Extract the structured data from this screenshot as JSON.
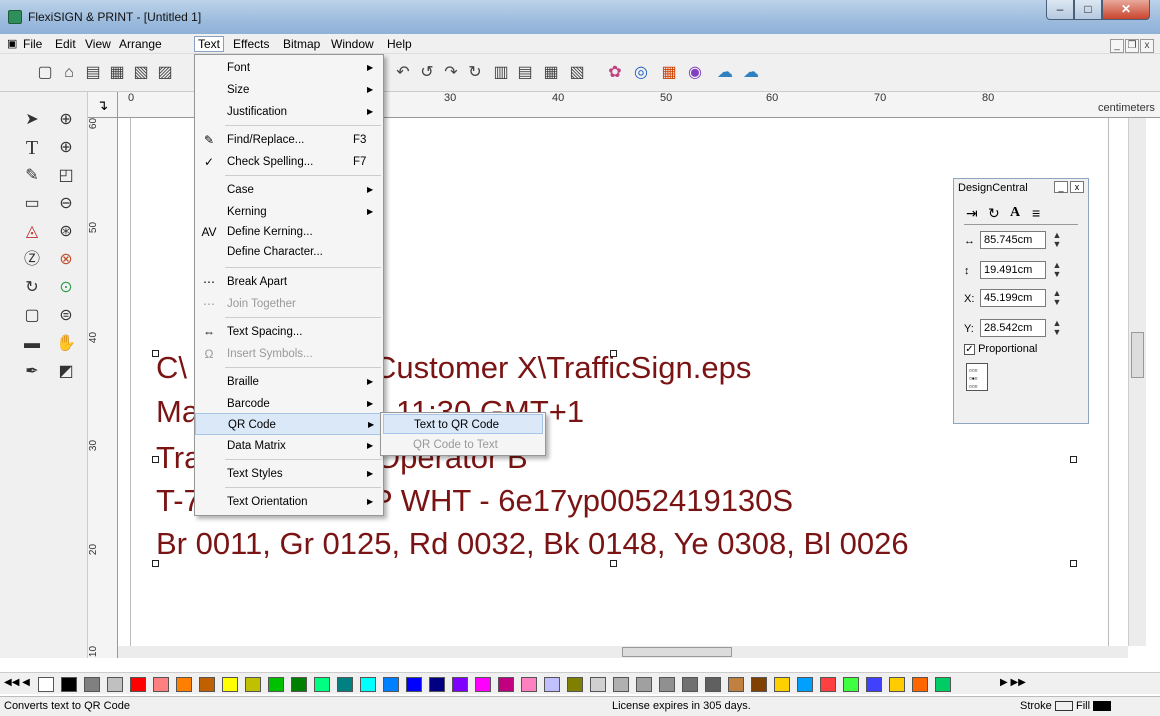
{
  "window": {
    "title": "FlexiSIGN & PRINT - [Untitled 1]"
  },
  "menubar": {
    "items": [
      "File",
      "Edit",
      "View",
      "Arrange",
      "Text",
      "Effects",
      "Bitmap",
      "Window",
      "Help"
    ]
  },
  "ruler": {
    "h_labels": [
      "0",
      "30",
      "40",
      "50",
      "60",
      "70",
      "80"
    ],
    "unit": "centimeters",
    "v_labels": [
      "60",
      "50",
      "40",
      "30",
      "20",
      "10"
    ]
  },
  "text_menu": {
    "items": [
      {
        "label": "Font",
        "submenu": true
      },
      {
        "label": "Size",
        "submenu": true
      },
      {
        "label": "Justification",
        "submenu": true
      },
      {
        "label": "Find/Replace...",
        "shortcut": "F3"
      },
      {
        "label": "Check Spelling...",
        "shortcut": "F7"
      },
      {
        "label": "Case",
        "submenu": true
      },
      {
        "label": "Kerning",
        "submenu": true
      },
      {
        "label": "Define Kerning..."
      },
      {
        "label": "Define Character..."
      },
      {
        "label": "Break Apart"
      },
      {
        "label": "Join Together",
        "disabled": true
      },
      {
        "label": "Text Spacing..."
      },
      {
        "label": "Insert Symbols...",
        "disabled": true
      },
      {
        "label": "Braille",
        "submenu": true
      },
      {
        "label": "Barcode",
        "submenu": true
      },
      {
        "label": "QR Code",
        "submenu": true,
        "highlighted": true
      },
      {
        "label": "Data Matrix",
        "submenu": true
      },
      {
        "label": "Text Styles",
        "submenu": true
      },
      {
        "label": "Text Orientation",
        "submenu": true
      }
    ]
  },
  "qr_submenu": {
    "items": [
      {
        "label": "Text to QR Code",
        "highlighted": true
      },
      {
        "label": "QR Code to Text",
        "disabled": true
      }
    ]
  },
  "canvas_text": {
    "line1_a": "C\\",
    "line1_b": "Customer X\\TrafficSign.eps",
    "line2_a": "Ma",
    "line2_b": "11:30 GMT+1",
    "line3_a": "Tra",
    "line3_b": "Operator B",
    "line4_a": "T-7",
    "line4_b": "P WHT - 6e17yp0052419130S",
    "line5": "Br 0011, Gr 0125, Rd 0032, Bk 0148, Ye 0308, Bl 0026"
  },
  "design_central": {
    "title": "DesignCentral",
    "width": "85.745cm",
    "height": "19.491cm",
    "x_label": "X:",
    "x": "45.199cm",
    "y_label": "Y:",
    "y": "28.542cm",
    "proportional_label": "Proportional",
    "proportional_checked": true
  },
  "status": {
    "message": "Converts text to QR Code",
    "license": "License expires in 305 days.",
    "stroke_label": "Stroke",
    "fill_label": "Fill"
  },
  "palette_colors": [
    "#ffffff",
    "#000000",
    "#808080",
    "#c0c0c0",
    "#ff0000",
    "#ff8080",
    "#ff8000",
    "#c06000",
    "#ffff00",
    "#c0c000",
    "#00c000",
    "#008000",
    "#00ff80",
    "#008080",
    "#00ffff",
    "#0080ff",
    "#0000ff",
    "#000080",
    "#8000ff",
    "#ff00ff",
    "#c00080",
    "#ff80c0",
    "#c0c0ff",
    "#808000",
    "#d0d0d0",
    "#b0b0b0",
    "#a0a0a0",
    "#909090",
    "#707070",
    "#606060",
    "#c08040",
    "#804000",
    "#ffd000",
    "#00a0ff",
    "#ff4040",
    "#40ff40",
    "#4040ff",
    "#ffcc00",
    "#ff6600",
    "#00cc66"
  ]
}
